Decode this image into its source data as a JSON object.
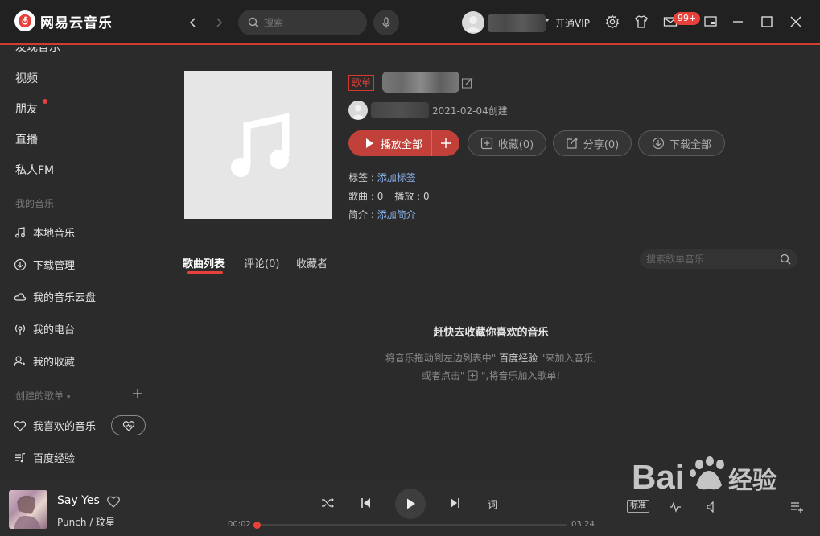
{
  "app": {
    "title": "网易云音乐",
    "search_placeholder": "搜索",
    "vip_label": "开通VIP",
    "message_badge": "99+"
  },
  "sidebar": {
    "top_items": [
      {
        "label": "发现音乐"
      },
      {
        "label": "视频"
      },
      {
        "label": "朋友"
      },
      {
        "label": "直播"
      },
      {
        "label": "私人FM"
      }
    ],
    "my_music_header": "我的音乐",
    "my_music_items": [
      {
        "label": "本地音乐",
        "icon": "music-note-icon"
      },
      {
        "label": "下载管理",
        "icon": "download-icon"
      },
      {
        "label": "我的音乐云盘",
        "icon": "cloud-icon"
      },
      {
        "label": "我的电台",
        "icon": "radio-icon"
      },
      {
        "label": "我的收藏",
        "icon": "collection-icon"
      }
    ],
    "created_header": "创建的歌单",
    "created_items": [
      {
        "label": "我喜欢的音乐",
        "icon": "heart-icon"
      },
      {
        "label": "百度经验",
        "icon": "playlist-icon"
      }
    ]
  },
  "playlist": {
    "tag": "歌单",
    "created_date": "2021-02-04创建",
    "buttons": {
      "play_all": "播放全部",
      "collect": "收藏(0)",
      "share": "分享(0)",
      "download_all": "下载全部"
    },
    "tags_label": "标签",
    "tags_link": "添加标签",
    "songs_label": "歌曲",
    "songs_count": "0",
    "plays_label": "播放",
    "plays_count": "0",
    "intro_label": "简介",
    "intro_link": "添加简介",
    "colon": " : "
  },
  "tabs": [
    {
      "label": "歌曲列表",
      "active": true
    },
    {
      "label": "评论(0)",
      "active": false
    },
    {
      "label": "收藏者",
      "active": false
    }
  ],
  "playlist_search_placeholder": "搜索歌单音乐",
  "empty_state": {
    "title": "赶快去收藏你喜欢的音乐",
    "line1_pre": "将音乐拖动到左边列表中\"",
    "line1_playlist": " 百度经验 ",
    "line1_post": "\"来加入音乐,",
    "line2_pre": "或者点击\"",
    "line2_post": "\",将音乐加入歌单!"
  },
  "player": {
    "song_title": "Say Yes",
    "artist": "Punch / 玟星",
    "current_time": "00:02",
    "total_time": "03:24",
    "progress": 0.01,
    "lyric_label": "词",
    "quality_label": "标准"
  },
  "colors": {
    "accent": "#e8413b",
    "link": "#86aee6",
    "background": "#2b2b2b",
    "titlebar": "#212121"
  }
}
